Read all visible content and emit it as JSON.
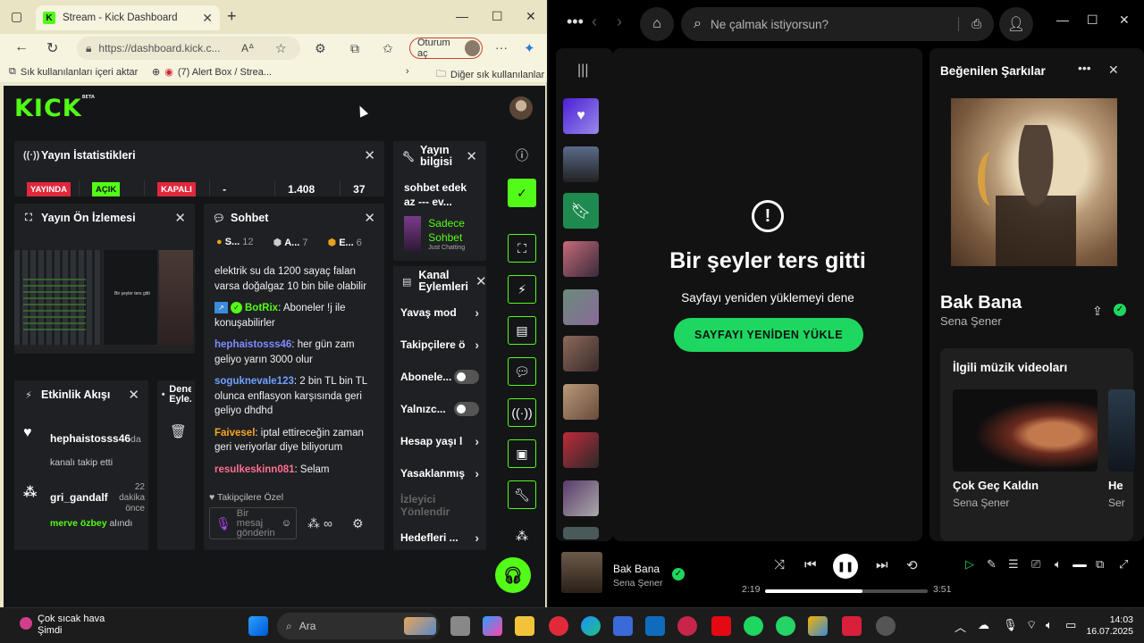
{
  "browser": {
    "tab_title": "Stream - Kick Dashboard",
    "url": "https://dashboard.kick.c...",
    "signin_label": "Oturum aç",
    "bookmarks": [
      "Sık kullanılanları içeri aktar",
      "(7) Alert Box / Strea...",
      "Diğer sık kullanılanlar"
    ]
  },
  "kick": {
    "logo": "KICK",
    "logo_badge": "BETA",
    "stats": {
      "title": "Yayın İstatistikleri",
      "live": "YAYINDA",
      "open": "AÇIK",
      "closed": "KAPALI",
      "dash": "-",
      "viewers": "1.408",
      "count": "37"
    },
    "preview": {
      "title": "Yayın Ön İzlemesi",
      "inner_text": "Bir şeyler ters gitti"
    },
    "chat": {
      "title": "Sohbet",
      "tabs": [
        {
          "label": "S...",
          "count": "12"
        },
        {
          "label": "A...",
          "count": "7"
        },
        {
          "label": "E...",
          "count": "6"
        }
      ],
      "intro": "elektrik su da 1200 sayaç falan varsa doğalgaz 10 bin bile olabilir",
      "messages": [
        {
          "user": "BotRix",
          "text": " Aboneler !j ile konuşabilirler"
        },
        {
          "user": "hephaistosss46",
          "text": " her gün zam geliyo yarın 3000 olur"
        },
        {
          "user": "soguknevale123",
          "text": " 2 bin TL bin TL olunca enflasyon karşısında geri geliyo dhdhd"
        },
        {
          "user": "Faivesel",
          "text": " iptal ettireceğin zaman geri veriyorlar diye biliyorum"
        },
        {
          "user": "resulkeskinn081",
          "text": " Selam"
        }
      ],
      "follow_only": "Takipçilere Özel",
      "input_placeholder": "Bir mesaj gönderin"
    },
    "info": {
      "title": "Yayın bilgisi",
      "stream_title": "sohbet edek az --- ev...",
      "category": "Sadece Sohbet",
      "category_extra": "Just Chatting"
    },
    "actions": {
      "title": "Kanal Eylemleri",
      "items": [
        "Yavaş mod",
        "Takipçilere ö",
        "Abonele...",
        "Yalnızc...",
        "Hesap yaşı l",
        "Yasaklanmış",
        "İzleyici Yönlendir",
        "Hedefleri ..."
      ]
    },
    "activity": {
      "title": "Etkinlik Akışı",
      "e1_user": "hephaistosss46",
      "e1_suffix": "da",
      "e1_sub": "kanalı takip etti",
      "e2_user": "gri_gandalf",
      "e2_time": "22 dakika önce",
      "e2_from": "merve özbey",
      "e2_sub": "alındı"
    },
    "extra": {
      "title": "Deneme Eyle..."
    }
  },
  "spotify": {
    "search_placeholder": "Ne çalmak istiyorsun?",
    "error_title": "Bir şeyler ters gitti",
    "error_sub": "Sayfayı yeniden yüklemeyi dene",
    "reload_label": "SAYFAYI YENİDEN YÜKLE",
    "side_title": "Beğenilen Şarkılar",
    "song_title": "Bak Bana",
    "song_artist": "Sena Şener",
    "videos_title": "İlgili müzik videoları",
    "video1_title": "Çok Geç Kaldın",
    "video1_artist": "Sena Şener",
    "video2_title": "He",
    "video2_artist": "Ser",
    "np_title": "Bak Bana",
    "np_artist": "Sena Şener",
    "time_elapsed": "2:19",
    "time_total": "3:51",
    "progress": 0.6
  },
  "taskbar": {
    "weather_title": "Çok sıcak hava",
    "weather_sub": "Şimdi",
    "search_label": "Ara",
    "time": "14:03",
    "date": "16.07.2025"
  }
}
